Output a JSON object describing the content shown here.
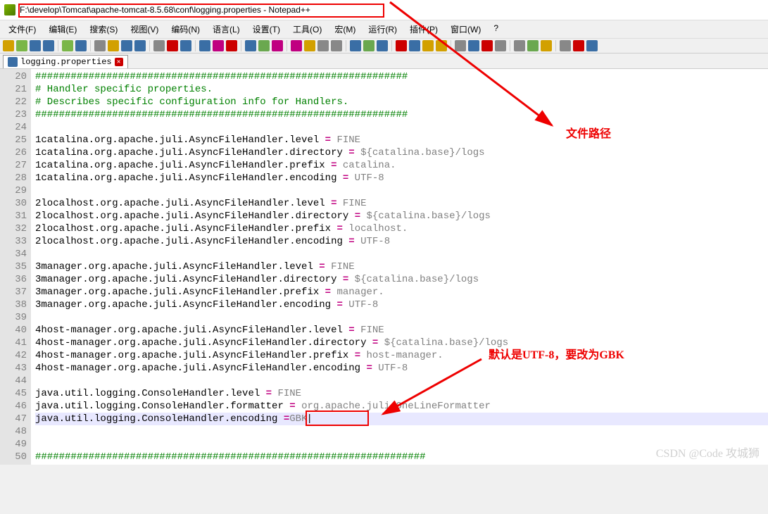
{
  "window": {
    "title_path": "F:\\develop\\Tomcat\\apache-tomcat-8.5.68\\conf\\logging.properties",
    "title_suffix": " - Notepad++"
  },
  "menu": [
    "文件(F)",
    "编辑(E)",
    "搜索(S)",
    "视图(V)",
    "编码(N)",
    "语言(L)",
    "设置(T)",
    "工具(O)",
    "宏(M)",
    "运行(R)",
    "插件(P)",
    "窗口(W)",
    "?"
  ],
  "tab": {
    "name": "logging.properties"
  },
  "lines": [
    {
      "n": 20,
      "t": "comment",
      "s": "###############################################################"
    },
    {
      "n": 21,
      "t": "comment",
      "s": "# Handler specific properties."
    },
    {
      "n": 22,
      "t": "comment",
      "s": "# Describes specific configuration info for Handlers."
    },
    {
      "n": 23,
      "t": "comment",
      "s": "###############################################################"
    },
    {
      "n": 24,
      "t": "blank",
      "s": ""
    },
    {
      "n": 25,
      "t": "kv",
      "k": "1catalina.org.apache.juli.AsyncFileHandler.level ",
      "v": " FINE"
    },
    {
      "n": 26,
      "t": "kv",
      "k": "1catalina.org.apache.juli.AsyncFileHandler.directory ",
      "v": " ${catalina.base}/logs"
    },
    {
      "n": 27,
      "t": "kv",
      "k": "1catalina.org.apache.juli.AsyncFileHandler.prefix ",
      "v": " catalina."
    },
    {
      "n": 28,
      "t": "kv",
      "k": "1catalina.org.apache.juli.AsyncFileHandler.encoding ",
      "v": " UTF-8"
    },
    {
      "n": 29,
      "t": "blank",
      "s": ""
    },
    {
      "n": 30,
      "t": "kv",
      "k": "2localhost.org.apache.juli.AsyncFileHandler.level ",
      "v": " FINE"
    },
    {
      "n": 31,
      "t": "kv",
      "k": "2localhost.org.apache.juli.AsyncFileHandler.directory ",
      "v": " ${catalina.base}/logs"
    },
    {
      "n": 32,
      "t": "kv",
      "k": "2localhost.org.apache.juli.AsyncFileHandler.prefix ",
      "v": " localhost."
    },
    {
      "n": 33,
      "t": "kv",
      "k": "2localhost.org.apache.juli.AsyncFileHandler.encoding ",
      "v": " UTF-8"
    },
    {
      "n": 34,
      "t": "blank",
      "s": ""
    },
    {
      "n": 35,
      "t": "kv",
      "k": "3manager.org.apache.juli.AsyncFileHandler.level ",
      "v": " FINE"
    },
    {
      "n": 36,
      "t": "kv",
      "k": "3manager.org.apache.juli.AsyncFileHandler.directory ",
      "v": " ${catalina.base}/logs"
    },
    {
      "n": 37,
      "t": "kv",
      "k": "3manager.org.apache.juli.AsyncFileHandler.prefix ",
      "v": " manager."
    },
    {
      "n": 38,
      "t": "kv",
      "k": "3manager.org.apache.juli.AsyncFileHandler.encoding ",
      "v": " UTF-8"
    },
    {
      "n": 39,
      "t": "blank",
      "s": ""
    },
    {
      "n": 40,
      "t": "kv",
      "k": "4host-manager.org.apache.juli.AsyncFileHandler.level ",
      "v": " FINE"
    },
    {
      "n": 41,
      "t": "kv",
      "k": "4host-manager.org.apache.juli.AsyncFileHandler.directory ",
      "v": " ${catalina.base}/logs"
    },
    {
      "n": 42,
      "t": "kv",
      "k": "4host-manager.org.apache.juli.AsyncFileHandler.prefix ",
      "v": " host-manager."
    },
    {
      "n": 43,
      "t": "kv",
      "k": "4host-manager.org.apache.juli.AsyncFileHandler.encoding ",
      "v": " UTF-8"
    },
    {
      "n": 44,
      "t": "blank",
      "s": ""
    },
    {
      "n": 45,
      "t": "kv",
      "k": "java.util.logging.ConsoleHandler.level ",
      "v": " FINE"
    },
    {
      "n": 46,
      "t": "kv",
      "k": "java.util.logging.ConsoleHandler.formatter ",
      "v": " org.apache.juli.OneLineFormatter"
    },
    {
      "n": 47,
      "t": "kv",
      "k": "java.util.logging.ConsoleHandler.encoding ",
      "v": "GBK"
    },
    {
      "n": 48,
      "t": "blank",
      "s": ""
    },
    {
      "n": 49,
      "t": "blank",
      "s": ""
    },
    {
      "n": 50,
      "t": "comment-cut",
      "s": "##################################################################"
    }
  ],
  "caret_line": 47,
  "annotations": {
    "path_label": "文件路径",
    "encoding_label": "默认是UTF-8，要改为GBK"
  },
  "watermark": "CSDN @Code 攻城狮",
  "toolbar_colors": [
    "#d2a000",
    "#7ab648",
    "#3a6ea5",
    "#3a6ea5",
    "#7ab648",
    "#3a6ea5",
    "#888",
    "#d2a000",
    "#3a6ea5",
    "#3a6ea5",
    "#888",
    "#c00",
    "#3a6ea5",
    "#3a6ea5",
    "#c00080",
    "#c00",
    "#3a6ea5",
    "#6aa84f",
    "#c00080",
    "#c00080",
    "#d2a000",
    "#888",
    "#888",
    "#3a6ea5",
    "#6aa84f",
    "#3a6ea5",
    "#c00",
    "#3a6ea5",
    "#d2a000",
    "#d2a000",
    "#888",
    "#3a6ea5",
    "#c00",
    "#888",
    "#888",
    "#6aa84f",
    "#d2a000",
    "#888",
    "#c00",
    "#3a6ea5"
  ]
}
